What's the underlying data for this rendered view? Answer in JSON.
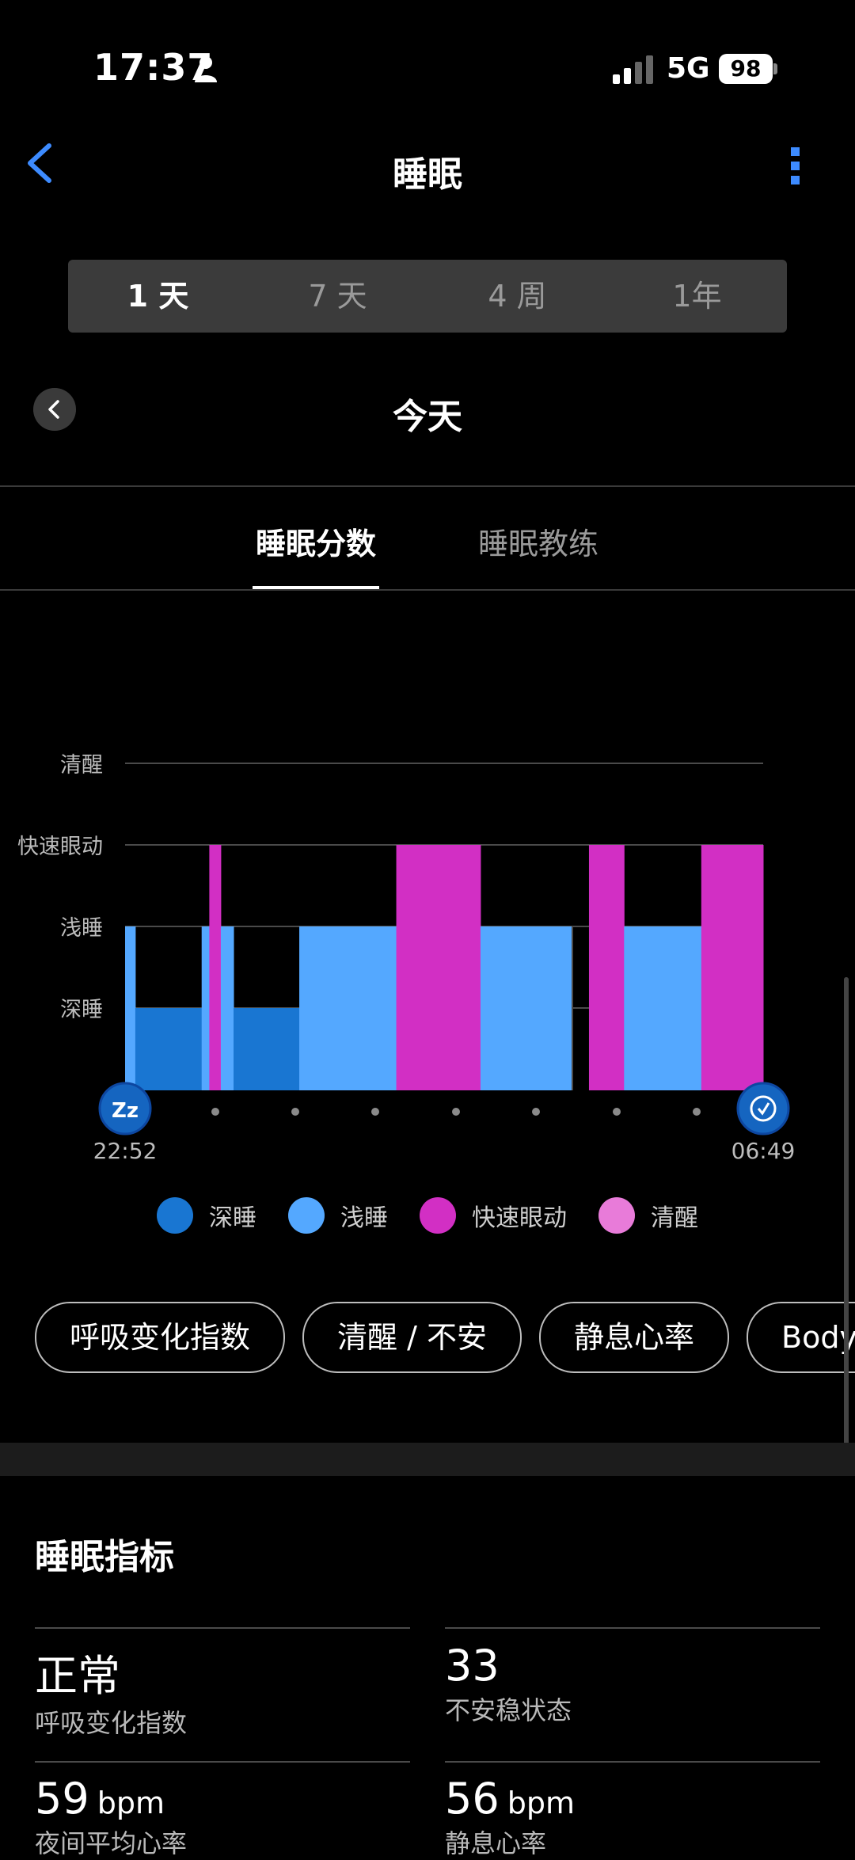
{
  "status_bar": {
    "time": "17:37",
    "network": "5G",
    "battery": "98"
  },
  "header": {
    "title": "睡眠"
  },
  "range_tabs": [
    "1 天",
    "7 天",
    "4 周",
    "1年"
  ],
  "date_nav": {
    "label": "今天"
  },
  "tabs": [
    "睡眠分数",
    "睡眠教练"
  ],
  "chart_data": {
    "type": "area",
    "y_levels": [
      "清醒",
      "快速眼动",
      "浅睡",
      "深睡"
    ],
    "start_time": "22:52",
    "end_time": "06:49",
    "segments": [
      {
        "start": 0.0,
        "end": 0.016,
        "stage": "light"
      },
      {
        "start": 0.016,
        "end": 0.12,
        "stage": "deep"
      },
      {
        "start": 0.12,
        "end": 0.132,
        "stage": "light"
      },
      {
        "start": 0.132,
        "end": 0.15,
        "stage": "rem"
      },
      {
        "start": 0.15,
        "end": 0.17,
        "stage": "light"
      },
      {
        "start": 0.17,
        "end": 0.273,
        "stage": "deep"
      },
      {
        "start": 0.273,
        "end": 0.425,
        "stage": "light"
      },
      {
        "start": 0.425,
        "end": 0.557,
        "stage": "rem"
      },
      {
        "start": 0.557,
        "end": 0.701,
        "stage": "light"
      },
      {
        "start": 0.701,
        "end": 0.727,
        "stage": "awake_gap"
      },
      {
        "start": 0.727,
        "end": 0.782,
        "stage": "rem"
      },
      {
        "start": 0.782,
        "end": 0.903,
        "stage": "light"
      },
      {
        "start": 0.903,
        "end": 1.0,
        "stage": "rem"
      }
    ],
    "colors": {
      "deep": "#1976d2",
      "light": "#54a8ff",
      "rem": "#d22fc4",
      "awake": "#e87bd9"
    },
    "grid": true
  },
  "legend": [
    {
      "label": "深睡",
      "color": "#1976d2"
    },
    {
      "label": "浅睡",
      "color": "#54a8ff"
    },
    {
      "label": "快速眼动",
      "color": "#d22fc4"
    },
    {
      "label": "清醒",
      "color": "#e87bd9"
    }
  ],
  "chips": [
    "呼吸变化指数",
    "清醒 / 不安",
    "静息心率",
    "Body"
  ],
  "metrics": {
    "title": "睡眠指标",
    "items": [
      {
        "value": "正常",
        "unit": "",
        "label": "呼吸变化指数"
      },
      {
        "value": "33",
        "unit": "",
        "label": "不安稳状态"
      },
      {
        "value": "59",
        "unit": "bpm",
        "label": "夜间平均心率"
      },
      {
        "value": "56",
        "unit": "bpm",
        "label": "静息心率"
      }
    ]
  }
}
